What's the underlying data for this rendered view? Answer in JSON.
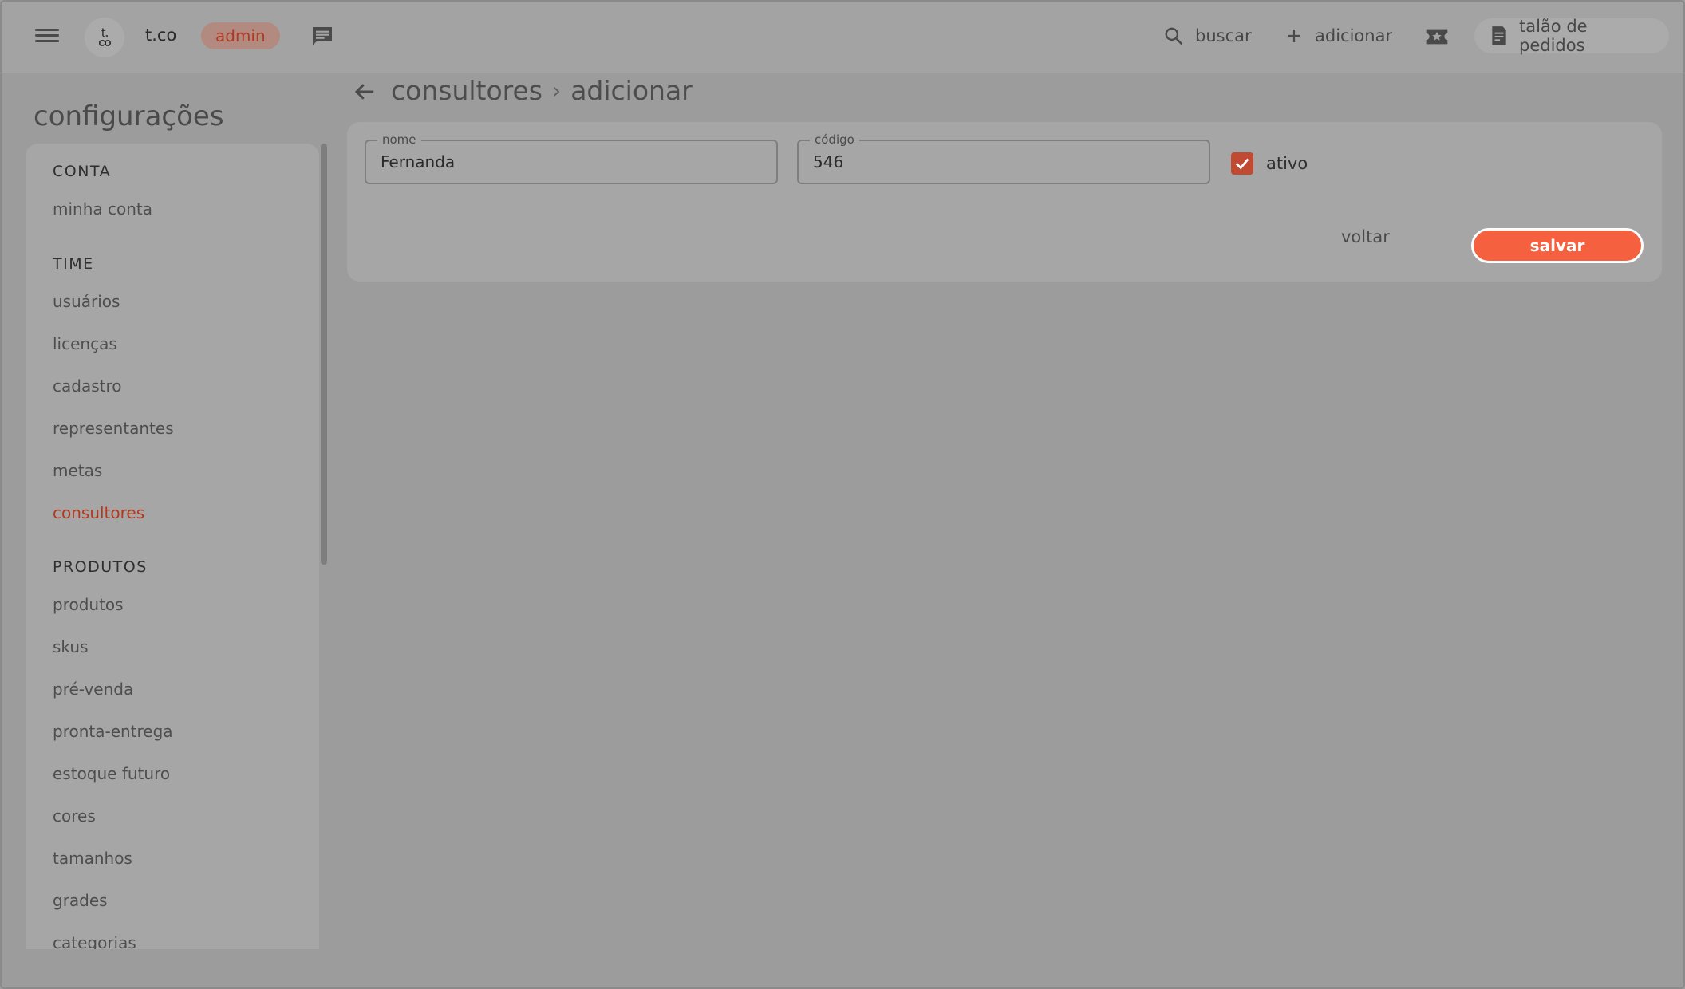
{
  "header": {
    "logo_text": "t.co",
    "company": "t.co",
    "role_badge": "admin",
    "actions": {
      "search": "buscar",
      "add": "adicionar",
      "orders": "talão de pedidos"
    }
  },
  "sidebar": {
    "title": "configurações",
    "groups": [
      {
        "title": "CONTA",
        "items": [
          "minha conta"
        ]
      },
      {
        "title": "TIME",
        "items": [
          "usuários",
          "licenças",
          "cadastro",
          "representantes",
          "metas",
          "consultores"
        ]
      },
      {
        "title": "PRODUTOS",
        "items": [
          "produtos",
          "skus",
          "pré-venda",
          "pronta-entrega",
          "estoque futuro",
          "cores",
          "tamanhos",
          "grades",
          "categorias"
        ]
      }
    ],
    "active_item": "consultores"
  },
  "main": {
    "breadcrumb": [
      "consultores",
      "adicionar"
    ],
    "form": {
      "name_label": "nome",
      "name_value": "Fernanda",
      "code_label": "código",
      "code_value": "546",
      "active_label": "ativo",
      "active_checked": true,
      "back_button": "voltar",
      "save_button": "salvar"
    }
  },
  "colors": {
    "accent": "#f5603f",
    "active_text": "#b3381f",
    "checkbox": "#c04a32"
  }
}
